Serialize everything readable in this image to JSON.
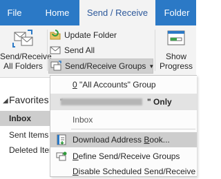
{
  "tabs": {
    "file": "File",
    "home": "Home",
    "send_receive": "Send / Receive",
    "folder": "Folder"
  },
  "ribbon": {
    "send_receive_all_line1": "Send/Receive",
    "send_receive_all_line2": "All Folders",
    "update_folder": "Update Folder",
    "send_all": "Send All",
    "send_receive_groups": "Send/Receive Groups",
    "show_progress_line1": "Show",
    "show_progress_line2": "Progress"
  },
  "folder_pane": {
    "favorites": "Favorites",
    "items": [
      "Inbox",
      "Sent Items",
      "Deleted Items"
    ]
  },
  "menu": {
    "all_accounts_prefix": "0",
    "all_accounts_rest": " \"All Accounts\" Group",
    "account_only_open_quote": "\"",
    "account_only_label": "\" Only",
    "inbox": "Inbox",
    "download_pre": "Download Address ",
    "download_ul": "B",
    "download_post": "ook...",
    "define_pre": "",
    "define_ul": "D",
    "define_post": "efine Send/Receive Groups",
    "disable_pre": "",
    "disable_ul": "D",
    "disable_post": "isable Scheduled Send/Receive"
  },
  "colors": {
    "tab_bar": "#2b79c6",
    "ribbon_bg": "#f3f3f3",
    "active_tab_text": "#2b579a",
    "highlight": "#cdcdcd"
  }
}
